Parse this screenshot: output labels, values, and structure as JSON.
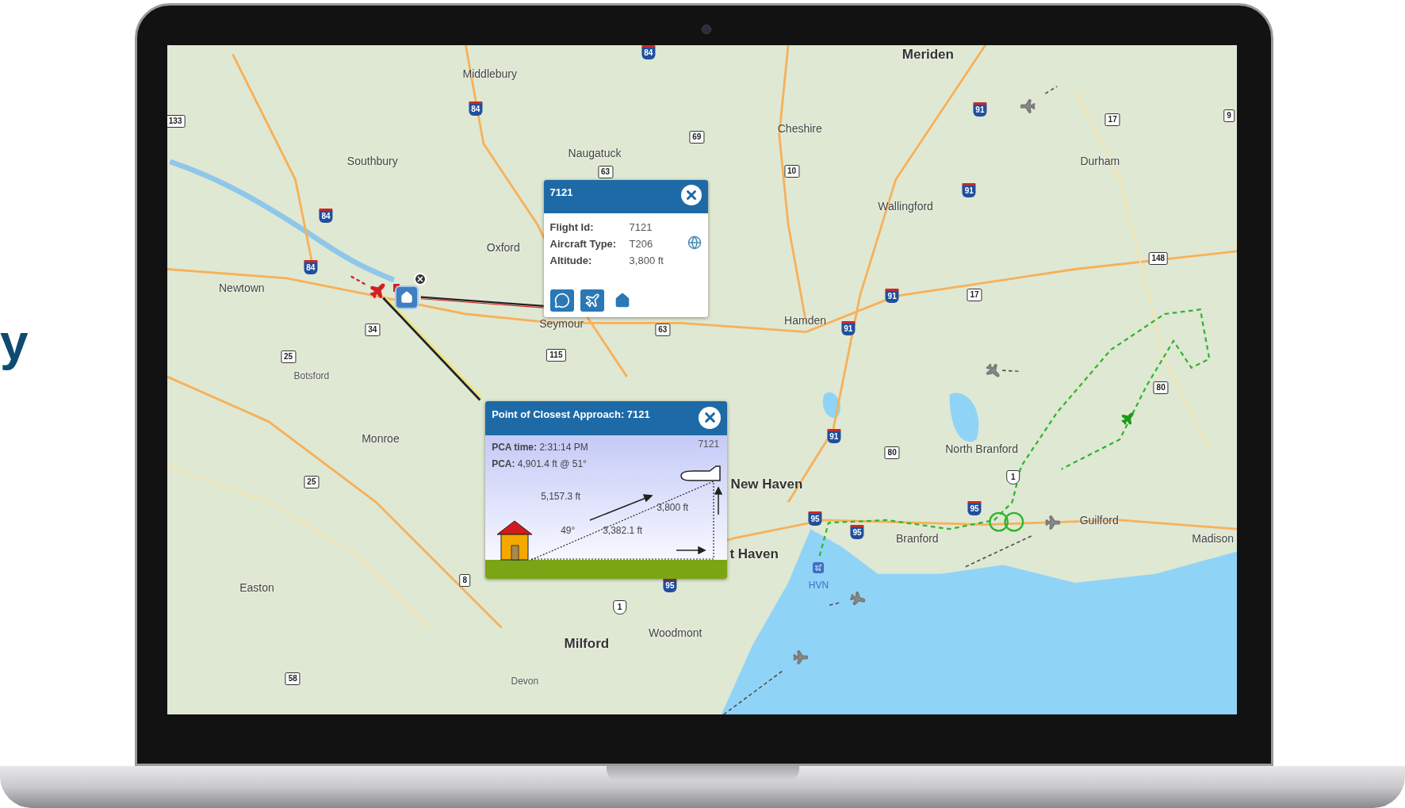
{
  "heading_fragment": "y",
  "map": {
    "place_labels": [
      {
        "text": "Middlebury",
        "kind": "town"
      },
      {
        "text": "Meriden",
        "kind": "major"
      },
      {
        "text": "Cheshire",
        "kind": "town"
      },
      {
        "text": "Naugatuck",
        "kind": "town"
      },
      {
        "text": "Southbury",
        "kind": "town"
      },
      {
        "text": "Durham",
        "kind": "town"
      },
      {
        "text": "Wallingford",
        "kind": "town"
      },
      {
        "text": "Oxford",
        "kind": "town"
      },
      {
        "text": "Newtown",
        "kind": "town"
      },
      {
        "text": "Hamden",
        "kind": "town"
      },
      {
        "text": "Seymour",
        "kind": "town"
      },
      {
        "text": "Botsford",
        "kind": "small"
      },
      {
        "text": "Monroe",
        "kind": "town"
      },
      {
        "text": "North Branford",
        "kind": "town"
      },
      {
        "text": "New Haven",
        "kind": "major"
      },
      {
        "text": "Guilford",
        "kind": "town"
      },
      {
        "text": "Branford",
        "kind": "town"
      },
      {
        "text": "Madison",
        "kind": "town"
      },
      {
        "text": "t Haven",
        "kind": "major"
      },
      {
        "text": "Easton",
        "kind": "town"
      },
      {
        "text": "Woodmont",
        "kind": "town"
      },
      {
        "text": "Milford",
        "kind": "major"
      },
      {
        "text": "Devon",
        "kind": "small"
      }
    ],
    "airport_code": "HVN",
    "route_shields": [
      {
        "number": "84",
        "kind": "interstate"
      },
      {
        "number": "84",
        "kind": "interstate"
      },
      {
        "number": "84",
        "kind": "interstate"
      },
      {
        "number": "84",
        "kind": "interstate"
      },
      {
        "number": "91",
        "kind": "interstate"
      },
      {
        "number": "91",
        "kind": "interstate"
      },
      {
        "number": "91",
        "kind": "interstate"
      },
      {
        "number": "91",
        "kind": "interstate"
      },
      {
        "number": "91",
        "kind": "interstate"
      },
      {
        "number": "95",
        "kind": "interstate"
      },
      {
        "number": "95",
        "kind": "interstate"
      },
      {
        "number": "95",
        "kind": "interstate"
      },
      {
        "number": "95",
        "kind": "interstate"
      },
      {
        "number": "69",
        "kind": "state"
      },
      {
        "number": "63",
        "kind": "state"
      },
      {
        "number": "10",
        "kind": "state"
      },
      {
        "number": "17",
        "kind": "state"
      },
      {
        "number": "9",
        "kind": "state"
      },
      {
        "number": "133",
        "kind": "state"
      },
      {
        "number": "148",
        "kind": "state"
      },
      {
        "number": "17",
        "kind": "state"
      },
      {
        "number": "34",
        "kind": "state"
      },
      {
        "number": "63",
        "kind": "state"
      },
      {
        "number": "115",
        "kind": "state"
      },
      {
        "number": "25",
        "kind": "state"
      },
      {
        "number": "80",
        "kind": "state"
      },
      {
        "number": "25",
        "kind": "state"
      },
      {
        "number": "80",
        "kind": "state"
      },
      {
        "number": "8",
        "kind": "state"
      },
      {
        "number": "58",
        "kind": "state"
      },
      {
        "number": "1",
        "kind": "us"
      },
      {
        "number": "1",
        "kind": "us"
      }
    ]
  },
  "flight_popup": {
    "title": "7121",
    "fields": [
      {
        "label": "Flight Id:",
        "value": "7121"
      },
      {
        "label": "Aircraft Type:",
        "value": "T206"
      },
      {
        "label": "Altitude:",
        "value": "3,800 ft"
      }
    ]
  },
  "pca_popup": {
    "title": "Point of Closest Approach: 7121",
    "flight_id": "7121",
    "lines": [
      "**PCA time:** 2:31:14 PM",
      "**PCA:** 4,901.4 ft @ 51°"
    ],
    "slant_distance": "5,157.3 ft",
    "altitude": "3,800 ft",
    "angle": "49°",
    "ground_distance": "3,382.1 ft"
  }
}
